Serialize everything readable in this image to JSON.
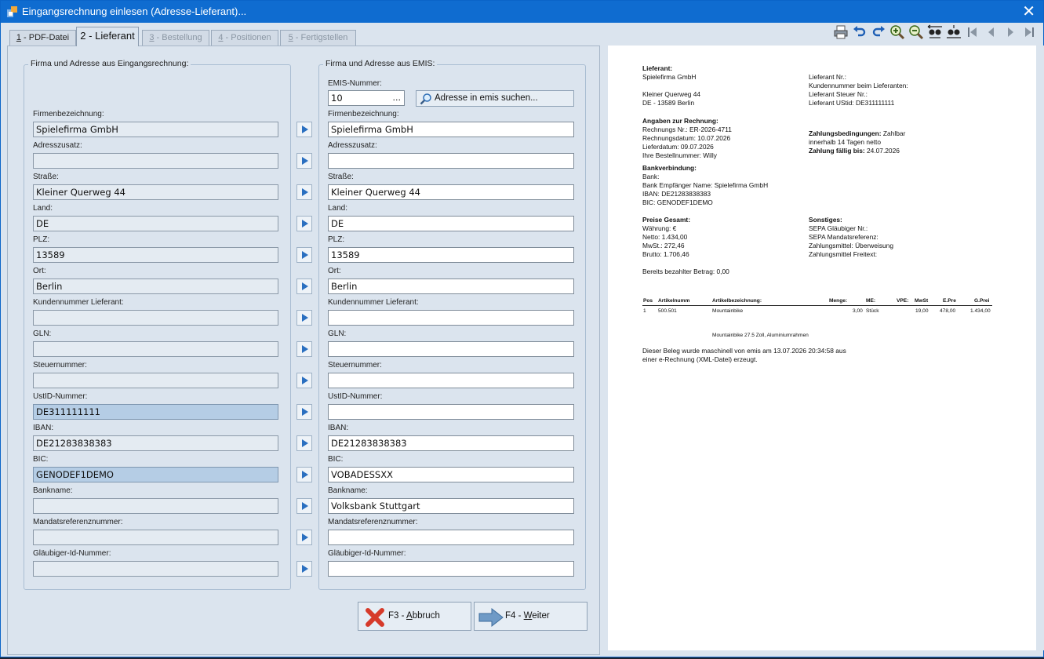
{
  "window": {
    "title": "Eingangsrechnung einlesen (Adresse-Lieferant)..."
  },
  "tabs": [
    {
      "num": "1",
      "label": "PDF-Datei"
    },
    {
      "num": "2",
      "label": "Lieferant"
    },
    {
      "num": "3",
      "label": "Bestellung"
    },
    {
      "num": "4",
      "label": "Positionen"
    },
    {
      "num": "5",
      "label": "Fertigstellen"
    }
  ],
  "toolbar": [
    "print-icon",
    "undo-icon",
    "redo-icon",
    "zoom-in-icon",
    "zoom-out-icon",
    "fit-width-icon",
    "fit-page-icon",
    "first-page-icon",
    "prev-page-icon",
    "next-page-icon",
    "last-page-icon"
  ],
  "left_group": {
    "title": "Firma und Adresse aus Eingangsrechnung:",
    "fields": [
      {
        "label": "Firmenbezeichnung:",
        "value": "Spielefirma GmbH",
        "highlight": false
      },
      {
        "label": "Adresszusatz:",
        "value": "",
        "highlight": false
      },
      {
        "label": "Straße:",
        "value": "Kleiner Querweg 44",
        "highlight": false
      },
      {
        "label": "Land:",
        "value": "DE",
        "highlight": false
      },
      {
        "label": "PLZ:",
        "value": "13589",
        "highlight": false
      },
      {
        "label": "Ort:",
        "value": "Berlin",
        "highlight": false
      },
      {
        "label": "Kundennummer Lieferant:",
        "value": "",
        "highlight": false
      },
      {
        "label": "GLN:",
        "value": "",
        "highlight": false
      },
      {
        "label": "Steuernummer:",
        "value": "",
        "highlight": false
      },
      {
        "label": "UstID-Nummer:",
        "value": "DE311111111",
        "highlight": true
      },
      {
        "label": "IBAN:",
        "value": "DE21283838383",
        "highlight": false
      },
      {
        "label": "BIC:",
        "value": "GENODEF1DEMO",
        "highlight": true
      },
      {
        "label": "Bankname:",
        "value": "",
        "highlight": false
      },
      {
        "label": "Mandatsreferenznummer:",
        "value": "",
        "highlight": false
      },
      {
        "label": "Gläubiger-Id-Nummer:",
        "value": "",
        "highlight": false
      }
    ]
  },
  "right_group": {
    "title": "Firma und Adresse aus EMIS:",
    "emis_label": "EMIS-Nummer:",
    "emis_value": "10",
    "emis_dots": "...",
    "search_button": "Adresse in emis suchen...",
    "fields": [
      {
        "label": "Firmenbezeichnung:",
        "value": "Spielefirma GmbH"
      },
      {
        "label": "Adresszusatz:",
        "value": ""
      },
      {
        "label": "Straße:",
        "value": "Kleiner Querweg 44"
      },
      {
        "label": "Land:",
        "value": "DE"
      },
      {
        "label": "PLZ:",
        "value": "13589"
      },
      {
        "label": "Ort:",
        "value": "Berlin"
      },
      {
        "label": "Kundennummer Lieferant:",
        "value": ""
      },
      {
        "label": "GLN:",
        "value": ""
      },
      {
        "label": "Steuernummer:",
        "value": ""
      },
      {
        "label": "UstID-Nummer:",
        "value": ""
      },
      {
        "label": "IBAN:",
        "value": "DE21283838383"
      },
      {
        "label": "BIC:",
        "value": "VOBADESSXX"
      },
      {
        "label": "Bankname:",
        "value": "Volksbank Stuttgart"
      },
      {
        "label": "Mandatsreferenznummer:",
        "value": ""
      },
      {
        "label": "Gläubiger-Id-Nummer:",
        "value": ""
      }
    ]
  },
  "buttons": {
    "cancel": {
      "prefix": "F3 - ",
      "mnemonic": "A",
      "rest": "bbruch"
    },
    "next": {
      "prefix": "F4 - ",
      "mnemonic": "W",
      "rest": "eiter"
    }
  },
  "preview": {
    "lieferant_h": "Lieferant:",
    "lieferant_name": "Spielefirma GmbH",
    "street": "Kleiner Querweg 44",
    "city": "DE - 13589 Berlin",
    "lief_nr": "Lieferant Nr.:",
    "kundennr": "Kundennummer beim Lieferanten:",
    "steuer": "Lieferant Steuer Nr.:",
    "ustid": "Lieferant UStid: DE311111111",
    "angaben_h": "Angaben zur Rechnung:",
    "rechnungsnr": "Rechnungs Nr.: ER-2026-4711",
    "rechnungsdatum": "Rechnungsdatum: 10.07.2026",
    "lieferdatum": "Lieferdatum: 09.07.2026",
    "bestellnummer": "Ihre Bestellnummer: Willy",
    "zahlung_h": "Zahlungsbedingungen:",
    "zahlung_v1": "Zahlbar",
    "zahlung_v2": "innerhalb 14 Tagen netto",
    "faellig_h": "Zahlung fällig bis:",
    "faellig_v": "24.07.2026",
    "bank_h": "Bankverbindung:",
    "bank": "Bank:",
    "empfaenger": "Bank Empfänger Name: Spielefirma GmbH",
    "iban": "IBAN: DE21283838383",
    "bic": "BIC: GENODEF1DEMO",
    "preise_h": "Preise Gesamt:",
    "waehrung": "Währung: €",
    "netto": "Netto: 1.434,00",
    "mwst": "MwSt.: 272,46",
    "brutto": "Brutto: 1.706,46",
    "sonstiges_h": "Sonstiges:",
    "sepa_g": "SEPA Gläubiger Nr.:",
    "sepa_m": "SEPA Mandatsreferenz:",
    "zahlungsmittel": "Zahlungsmittel: Überweisung",
    "zahlungsmittel_frei": "Zahlungsmittel Freitext:",
    "bezahlt": "Bereits bezahlter Betrag: 0,00",
    "table_headers": [
      "Pos",
      "Artikelnumm",
      "Artikelbezeichnung:",
      "Menge:",
      "ME:",
      "VPE:",
      "MwSt",
      "E.Pre",
      "G.Prei"
    ],
    "table_row": [
      "1",
      "500.501",
      "Mountainbike",
      "3,00",
      "Stück",
      "",
      "19,00",
      "478,00",
      "1.434,00"
    ],
    "row_note": "Mountainbike 27.5 Zoll, Aluminiumrahmen",
    "footer1": "Dieser Beleg wurde maschinell von emis am 13.07.2026  20:34:58 aus",
    "footer2": "einer e-Rechnung (XML-Datei) erzeugt."
  }
}
